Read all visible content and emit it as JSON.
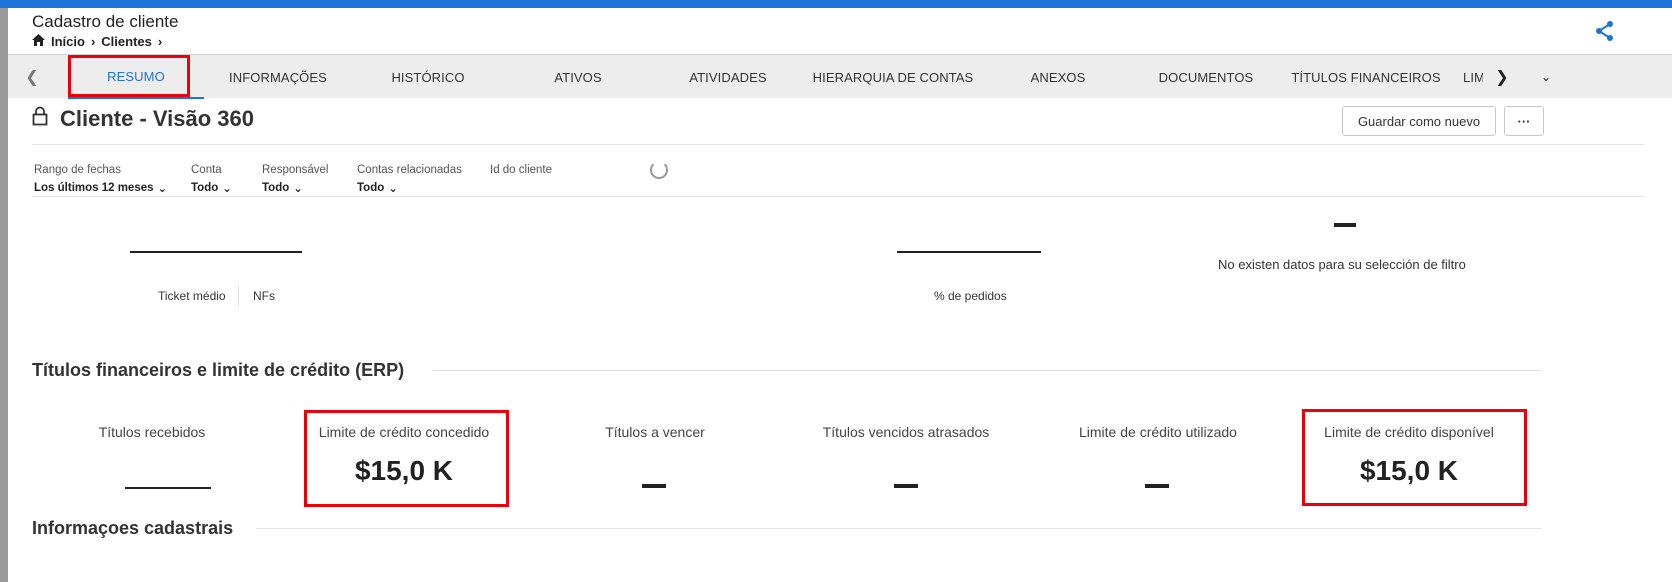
{
  "header": {
    "title": "Cadastro de cliente",
    "breadcrumb": [
      "Início",
      "Clientes"
    ]
  },
  "tabs": [
    {
      "label": "RESUMO",
      "active": true
    },
    {
      "label": "INFORMAÇÕES"
    },
    {
      "label": "HISTÓRICO"
    },
    {
      "label": "ATIVOS"
    },
    {
      "label": "ATIVIDADES"
    },
    {
      "label": "HIERARQUIA DE CONTAS"
    },
    {
      "label": "ANEXOS"
    },
    {
      "label": "DOCUMENTOS"
    },
    {
      "label": "TÍTULOS FINANCEIROS"
    },
    {
      "label": "LIM"
    }
  ],
  "dashboard": {
    "title": "Cliente - Visão 360",
    "save_button": "Guardar como nuevo",
    "more_button": "···"
  },
  "filters": [
    {
      "label": "Rango de fechas",
      "value": "Los últimos 12 meses"
    },
    {
      "label": "Conta",
      "value": "Todo"
    },
    {
      "label": "Responsável",
      "value": "Todo"
    },
    {
      "label": "Contas relacionadas",
      "value": "Todo"
    },
    {
      "label": "Id do cliente",
      "value": ""
    }
  ],
  "metrics": {
    "ticket_label": "Ticket médio",
    "nfs_label": "NFs",
    "pedidos_label": "% de pedidos",
    "no_data": "No existen datos para su selección de filtro"
  },
  "credit_section": {
    "title": "Títulos financeiros e limite de crédito (ERP)",
    "cards": [
      {
        "label": "Títulos recebidos",
        "value": ""
      },
      {
        "label": "Limite de crédito concedido",
        "value": "$15,0 K"
      },
      {
        "label": "Títulos a vencer",
        "value": ""
      },
      {
        "label": "Títulos vencidos atrasados",
        "value": ""
      },
      {
        "label": "Limite de crédito utilizado",
        "value": ""
      },
      {
        "label": "Limite de crédito disponível",
        "value": "$15,0 K"
      }
    ]
  },
  "info_section": {
    "title": "Informaçoes cadastrais"
  },
  "colors": {
    "accent": "#1c74d6",
    "highlight": "#e8000b"
  }
}
